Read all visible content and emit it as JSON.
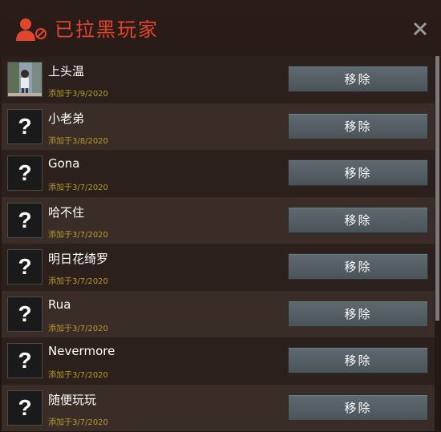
{
  "header": {
    "title": "已拉黑玩家",
    "icon": "blocked-user-icon",
    "accent_color": "#e0452e",
    "close_icon": "close-icon"
  },
  "list": {
    "items": [
      {
        "name": "上头温",
        "added": "添加于3/9/2020",
        "avatar": "photo",
        "remove_label": "移除"
      },
      {
        "name": "小老弟",
        "added": "添加于3/8/2020",
        "avatar": "?",
        "remove_label": "移除"
      },
      {
        "name": "Gona",
        "added": "添加于3/7/2020",
        "avatar": "?",
        "remove_label": "移除"
      },
      {
        "name": "哈不住",
        "added": "添加于3/7/2020",
        "avatar": "?",
        "remove_label": "移除"
      },
      {
        "name": "明日花绮罗",
        "added": "添加于3/7/2020",
        "avatar": "?",
        "remove_label": "移除"
      },
      {
        "name": "Rua",
        "added": "添加于3/7/2020",
        "avatar": "?",
        "remove_label": "移除"
      },
      {
        "name": "Nevermore",
        "added": "添加于3/7/2020",
        "avatar": "?",
        "remove_label": "移除"
      },
      {
        "name": "随便玩玩",
        "added": "添加于3/7/2020",
        "avatar": "?",
        "remove_label": "移除"
      }
    ]
  }
}
